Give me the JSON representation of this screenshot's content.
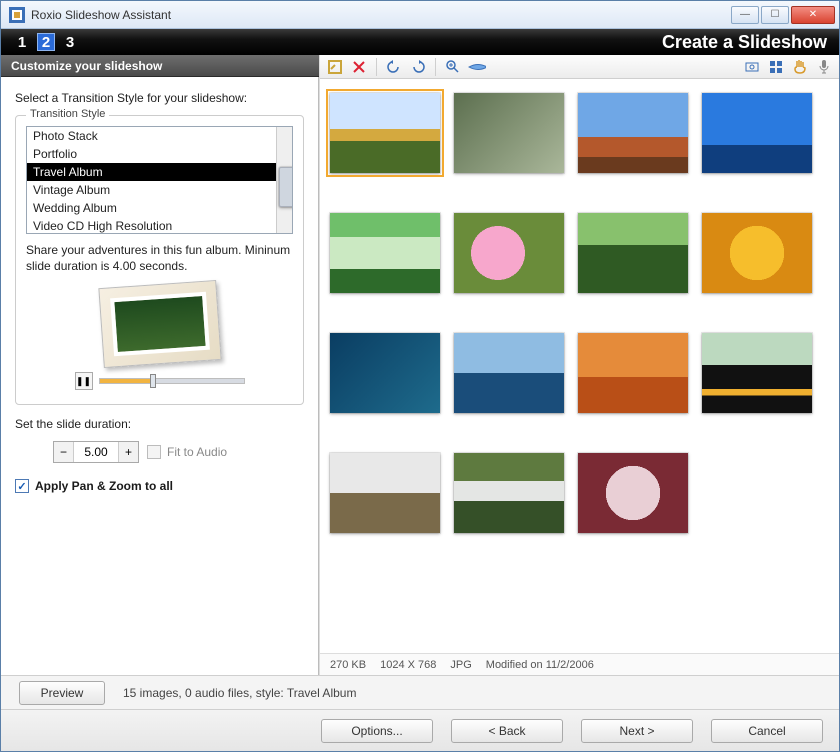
{
  "window": {
    "title": "Roxio Slideshow Assistant"
  },
  "stepbar": {
    "steps": [
      "1",
      "2",
      "3"
    ],
    "active_index": 1,
    "title": "Create a Slideshow"
  },
  "subheader": "Customize your slideshow",
  "left": {
    "select_label": "Select a Transition Style for your slideshow:",
    "fieldset_legend": "Transition Style",
    "styles": [
      {
        "label": "Photo Stack",
        "selected": false
      },
      {
        "label": "Portfolio",
        "selected": false
      },
      {
        "label": "Travel Album",
        "selected": true
      },
      {
        "label": "Vintage Album",
        "selected": false
      },
      {
        "label": "Wedding Album",
        "selected": false
      },
      {
        "label": "Video CD High Resolution",
        "selected": false
      }
    ],
    "description": "Share your adventures in this fun album. Mininum slide duration is 4.00 seconds.",
    "duration_label": "Set the slide duration:",
    "duration_value": "5.00",
    "fit_to_audio": "Fit to Audio",
    "apply_pan_zoom": "Apply Pan & Zoom to all",
    "apply_checked": true
  },
  "toolbar_icons": {
    "edit": "edit-icon",
    "delete": "delete-icon",
    "rotate_left": "rotate-left-icon",
    "rotate_right": "rotate-right-icon",
    "zoom": "zoom-icon",
    "panorama": "panorama-icon",
    "identify": "identify-icon",
    "grid": "grid-icon",
    "hand": "hand-icon",
    "mic": "mic-icon"
  },
  "thumbnails": [
    {
      "name": "autumn-trees",
      "selected": true
    },
    {
      "name": "mountain-stream",
      "selected": false
    },
    {
      "name": "desert-butte",
      "selected": false
    },
    {
      "name": "glacier-lagoon",
      "selected": false
    },
    {
      "name": "forest-path",
      "selected": false
    },
    {
      "name": "pink-blossom",
      "selected": false
    },
    {
      "name": "meadow-trees",
      "selected": false
    },
    {
      "name": "orange-flowers",
      "selected": false
    },
    {
      "name": "sea-turtle",
      "selected": false
    },
    {
      "name": "whale-tail",
      "selected": false
    },
    {
      "name": "sand-dunes",
      "selected": false
    },
    {
      "name": "toucan",
      "selected": false
    },
    {
      "name": "bare-trees-fog",
      "selected": false
    },
    {
      "name": "waterfall",
      "selected": false
    },
    {
      "name": "frosty-leaves",
      "selected": false
    }
  ],
  "status": {
    "size": "270 KB",
    "dimensions": "1024 X 768",
    "format": "JPG",
    "modified": "Modified on 11/2/2006"
  },
  "footer1": {
    "preview": "Preview",
    "summary": "15 images,  0 audio files, style: Travel Album"
  },
  "footer2": {
    "options": "Options...",
    "back": "<  Back",
    "next": "Next  >",
    "cancel": "Cancel"
  }
}
